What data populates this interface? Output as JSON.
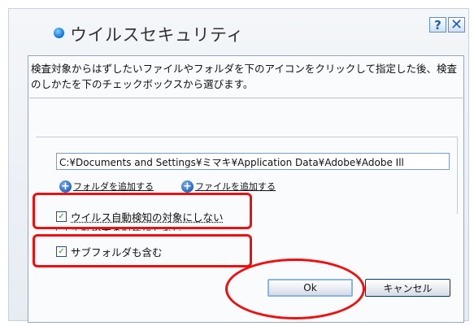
{
  "dialog": {
    "title": "ウイルスセキュリティ",
    "help_label": "?",
    "close_label": "✕"
  },
  "panel": {
    "instruction": "検査対象からはずしたいファイルやフォルダを下のアイコンをクリックして指定した後、検査のしかたを下のチェックボックスから選びます。",
    "path_value": "C:¥Documents and Settings¥ミマキ¥Application Data¥Adobe¥Adobe Ill",
    "add_folder_label": "フォルダを追加する",
    "add_file_label": "ファイルを追加する",
    "checkboxes": [
      {
        "label": "ウイルス自動検知の対象にしない",
        "checked": true
      },
      {
        "label": "手動検査の対象にしない",
        "checked": false
      },
      {
        "label": "サブフォルダも含む",
        "checked": true
      }
    ],
    "ok_label": "Ok",
    "cancel_label": "キャンセル"
  },
  "icons": {
    "title_icon": "blue-dot-icon",
    "add_icon": "plus-circle-icon",
    "check_mark": "✓"
  },
  "colors": {
    "highlight": "#ee1010",
    "accent": "#1e5fb8"
  }
}
